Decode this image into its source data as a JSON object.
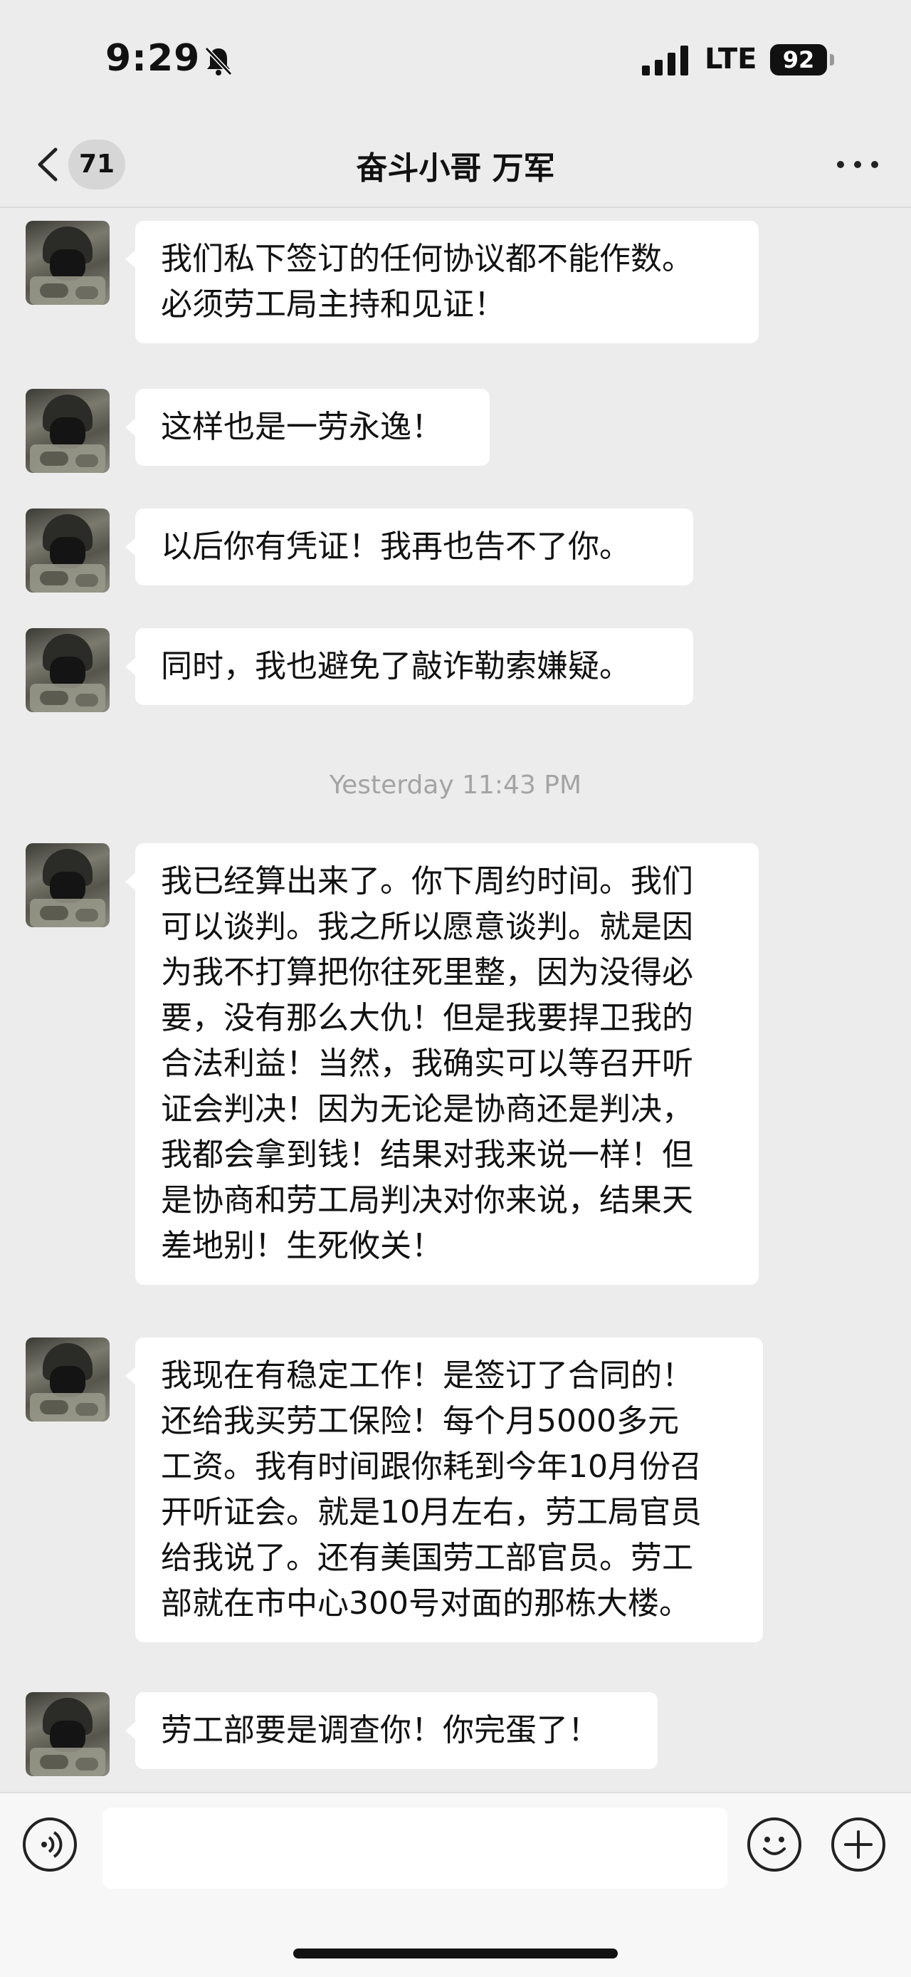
{
  "status_bar": {
    "time": "9:29",
    "network": "LTE",
    "battery": "92",
    "icons": [
      "bell-slash-icon",
      "signal-icon"
    ]
  },
  "nav": {
    "unread_count": "71",
    "title": "奋斗小哥 万军",
    "icons": [
      "chevron-left-icon",
      "more-icon"
    ]
  },
  "messages": [
    {
      "type": "text",
      "sender": "other",
      "text": "我们私下签订的任何协议都不能作数。\n必须劳工局主持和见证！"
    },
    {
      "type": "text",
      "sender": "other",
      "text": "这样也是一劳永逸！"
    },
    {
      "type": "text",
      "sender": "other",
      "text": "以后你有凭证！我再也告不了你。"
    },
    {
      "type": "text",
      "sender": "other",
      "text": "同时，我也避免了敲诈勒索嫌疑。"
    },
    {
      "type": "timestamp",
      "text": "Yesterday 11:43 PM"
    },
    {
      "type": "text",
      "sender": "other",
      "text": "我已经算出来了。你下周约时间。我们\n可以谈判。我之所以愿意谈判。就是因\n为我不打算把你往死里整，因为没得必\n要，没有那么大仇！但是我要捍卫我的\n合法利益！当然，我确实可以等召开听\n证会判决！因为无论是协商还是判决，\n我都会拿到钱！结果对我来说一样！但\n是协商和劳工局判决对你来说，结果天\n差地别！生死攸关！"
    },
    {
      "type": "text",
      "sender": "other",
      "text": "我现在有稳定工作！是签订了合同的！\n还给我买劳工保险！每个月5000多元\n工资。我有时间跟你耗到今年10月份召\n开听证会。就是10月左右，劳工局官员\n给我说了。还有美国劳工部官员。劳工\n部就在市中心300号对面的那栋大楼。"
    },
    {
      "type": "text",
      "sender": "other",
      "text": "劳工部要是调查你！你完蛋了！"
    }
  ],
  "input_bar": {
    "placeholder": "",
    "icons": [
      "voice-icon",
      "emoji-icon",
      "plus-icon"
    ]
  },
  "colors": {
    "background": "#ececec",
    "bubble": "#ffffff",
    "timestamp": "#a4a4a4"
  }
}
